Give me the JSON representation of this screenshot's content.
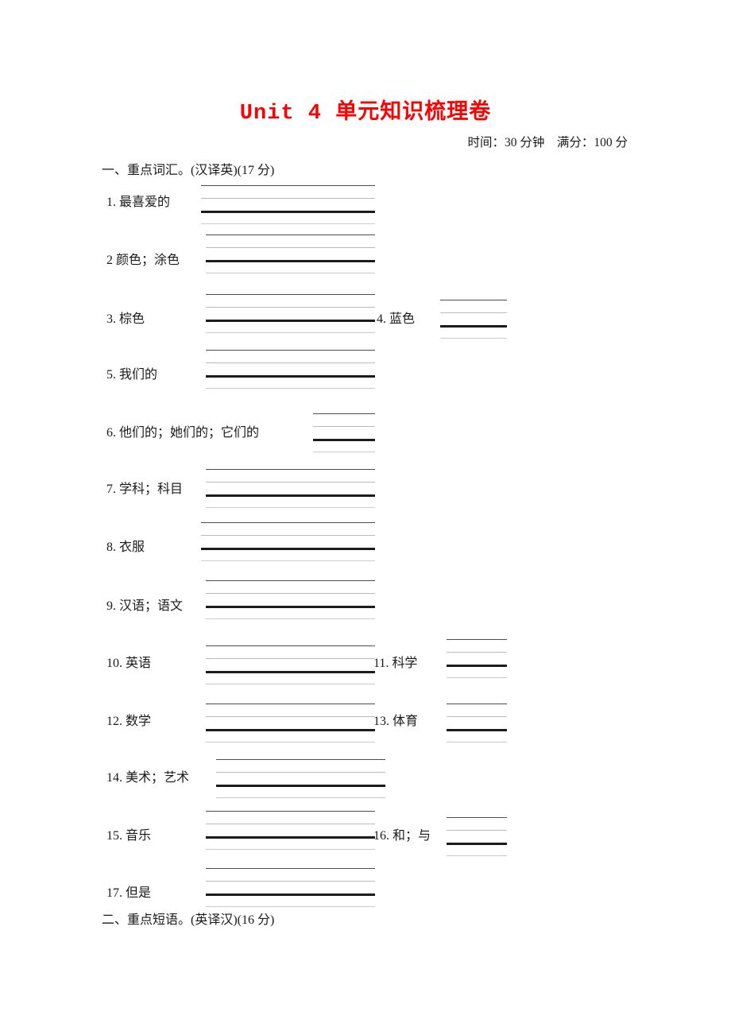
{
  "document": {
    "title": "Unit 4 单元知识梳理卷",
    "title_color": "#ff0000",
    "meta": "时间：30 分钟　满分：100 分"
  },
  "sections": [
    {
      "heading": "一、重点词汇。(汉译英)(17 分)",
      "items": [
        {
          "label": "1. 最喜爱的"
        },
        {
          "label": "2 颜色；涂色"
        },
        {
          "label": "3. 棕色"
        },
        {
          "label": "4. 蓝色"
        },
        {
          "label": "5. 我们的"
        },
        {
          "label": "6. 他们的；她们的；它们的"
        },
        {
          "label": "7. 学科；科目"
        },
        {
          "label": "8. 衣服"
        },
        {
          "label": "9. 汉语；语文"
        },
        {
          "label": "10. 英语"
        },
        {
          "label": "11. 科学"
        },
        {
          "label": "12. 数学"
        },
        {
          "label": "13. 体育"
        },
        {
          "label": "14. 美术；艺术"
        },
        {
          "label": "15. 音乐"
        },
        {
          "label": "16. 和；与"
        },
        {
          "label": "17. 但是"
        }
      ]
    },
    {
      "heading": "二、重点短语。(英译汉)(16 分)",
      "items": []
    }
  ]
}
